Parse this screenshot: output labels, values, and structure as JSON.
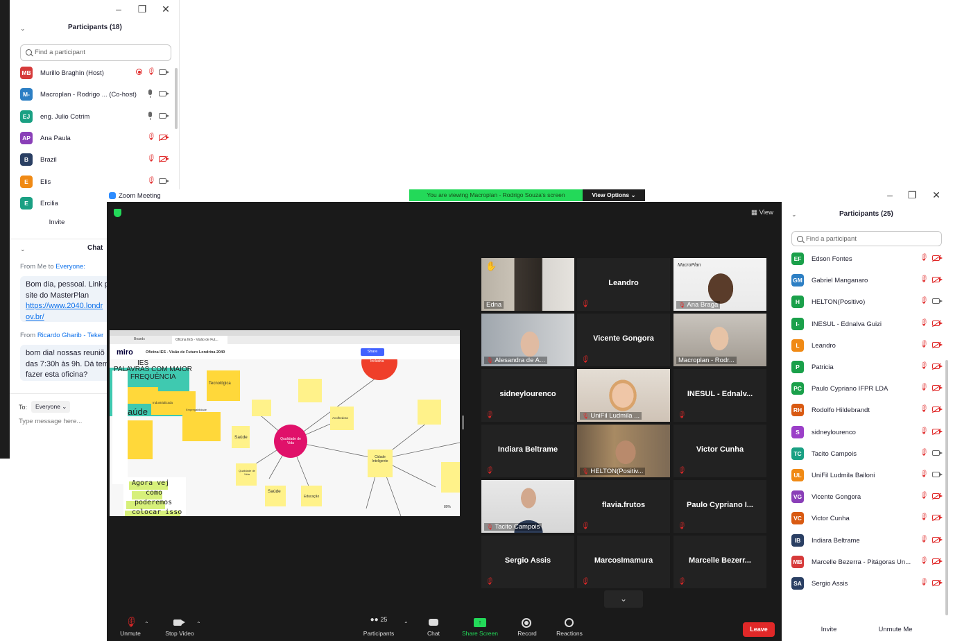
{
  "back_window": {
    "participants_title": "Participants (18)",
    "search_placeholder": "Find a participant",
    "participants": [
      {
        "initials": "MB",
        "name": "Murillo Braghin (Host)",
        "color": "#d63a3a"
      },
      {
        "initials": "M-",
        "name": "Macroplan - Rodrigo ... (Co-host)",
        "color": "#2d7fc4"
      },
      {
        "initials": "EJ",
        "name": "eng. Julio Cotrim",
        "color": "#1aa083"
      },
      {
        "initials": "AP",
        "name": "Ana Paula",
        "color": "#8a3fb8"
      },
      {
        "initials": "B",
        "name": "Brazil",
        "color": "#2a3f63"
      },
      {
        "initials": "E",
        "name": "Elis",
        "color": "#f08a15"
      },
      {
        "initials": "E",
        "name": "Ercilia",
        "color": "#1aa083"
      }
    ],
    "invite_label": "Invite",
    "chat_title": "Chat",
    "chat": [
      {
        "from": "From Me to ",
        "to": "Everyone:",
        "lines": [
          "Bom dia, pessoal. Link p",
          "site do MasterPlan"
        ],
        "links": [
          "https://www.2040.londr",
          "ov.br/"
        ]
      },
      {
        "from": "From ",
        "to": "Ricardo Gharib - Teker",
        "lines": [
          "bom dia! nossas reuniõ",
          "das 7:30h às 9h. Dá tem",
          "fazer esta oficina?"
        ]
      }
    ],
    "to_label": "To:",
    "to_value": "Everyone",
    "message_placeholder": "Type message here..."
  },
  "main_window": {
    "app_title": "Zoom Meeting",
    "banner": "You are viewing Macroplan - Rodrigo Souza's screen",
    "view_options": "View Options",
    "view_label": "View",
    "tiles": [
      {
        "name": "Edna",
        "type": "video",
        "active": true
      },
      {
        "name": "Leandro",
        "type": "name"
      },
      {
        "name": "Ana Braga",
        "type": "video"
      },
      {
        "name": "Alesandra de A...",
        "type": "video"
      },
      {
        "name": "Vicente Gongora",
        "type": "name"
      },
      {
        "name": "Macroplan - Rodr...",
        "type": "video"
      },
      {
        "name": "sidneylourenco",
        "type": "name"
      },
      {
        "name": "UniFil Ludmila ...",
        "type": "video"
      },
      {
        "name": "INESUL - Ednalv...",
        "type": "name"
      },
      {
        "name": "Indiara Beltrame",
        "type": "name"
      },
      {
        "name": "HELTON(Positiv...",
        "type": "video"
      },
      {
        "name": "Victor Cunha",
        "type": "name"
      },
      {
        "name": "Tacito Campois",
        "type": "video"
      },
      {
        "name": "flavia.frutos",
        "type": "name"
      },
      {
        "name": "Paulo Cypriano I...",
        "type": "name"
      },
      {
        "name": "Sergio Assis",
        "type": "name"
      },
      {
        "name": "MarcosImamura",
        "type": "name"
      },
      {
        "name": "Marcelle Bezerr...",
        "type": "name"
      }
    ],
    "macroplan_logo": "MacroPlan",
    "toolbar": {
      "unmute": "Unmute",
      "stop_video": "Stop Video",
      "participants": "Participants",
      "participants_count": "25",
      "chat": "Chat",
      "share_screen": "Share Screen",
      "record": "Record",
      "reactions": "Reactions",
      "leave": "Leave"
    }
  },
  "shared_screen": {
    "tab1": "Boards",
    "tab2": "Oficina IES - Visão de Fut...",
    "miro": "miro",
    "board_title": "Oficina IES - Visão de Futuro Londrina 2040",
    "share": "Share",
    "center_node": "Qualidade de Vida",
    "heading_lines": [
      "PALAVRAS COM MAIOR",
      "FREQUÊNCIA"
    ],
    "ies": "IES",
    "aude": "aúde",
    "notes": [
      "Tecnológica",
      "Industrializada",
      "Empregabilidade",
      "Saúde",
      "Qualidade de Vida",
      "Saúde",
      "Educação",
      "Acolhedora",
      "Cidade Inteligente",
      "Inclusiva"
    ],
    "handwriting": [
      "Agora vej",
      "como",
      "poderemos",
      "colocar isso"
    ],
    "zoom_pct": "89%"
  },
  "right_panel": {
    "title": "Participants (25)",
    "search_placeholder": "Find a participant",
    "participants": [
      {
        "initials": "EF",
        "name": "Edson Fontes",
        "color": "#1aa04a"
      },
      {
        "initials": "GM",
        "name": "Gabriel Manganaro",
        "color": "#2d7fc4"
      },
      {
        "initials": "H",
        "name": "HELTON(Positivo)",
        "color": "#1aa04a"
      },
      {
        "initials": "I-",
        "name": "INESUL - Ednalva Guizi",
        "color": "#1aa04a"
      },
      {
        "initials": "L",
        "name": "Leandro",
        "color": "#f08a15"
      },
      {
        "initials": "P",
        "name": "Patricia",
        "color": "#1aa04a"
      },
      {
        "initials": "PC",
        "name": "Paulo Cypriano IFPR LDA",
        "color": "#1aa04a"
      },
      {
        "initials": "RH",
        "name": "Rodolfo Hildebrandt",
        "color": "#d95a12"
      },
      {
        "initials": "S",
        "name": "sidneylourenco",
        "color": "#9b3fc8"
      },
      {
        "initials": "TC",
        "name": "Tacito Campois",
        "color": "#1aa083"
      },
      {
        "initials": "UL",
        "name": "UniFil Ludmila Bailoni",
        "color": "#f08a15"
      },
      {
        "initials": "VG",
        "name": "Vicente Gongora",
        "color": "#8a3fb8"
      },
      {
        "initials": "VC",
        "name": "Victor Cunha",
        "color": "#d95a12"
      },
      {
        "initials": "IB",
        "name": "Indiara Beltrame",
        "color": "#2a3f63"
      },
      {
        "initials": "MB",
        "name": "Marcelle Bezerra - Pitágoras Un...",
        "color": "#d63a3a"
      },
      {
        "initials": "SA",
        "name": "Sergio Assis",
        "color": "#2a3f63"
      }
    ],
    "invite_label": "Invite",
    "unmute_me_label": "Unmute Me"
  }
}
